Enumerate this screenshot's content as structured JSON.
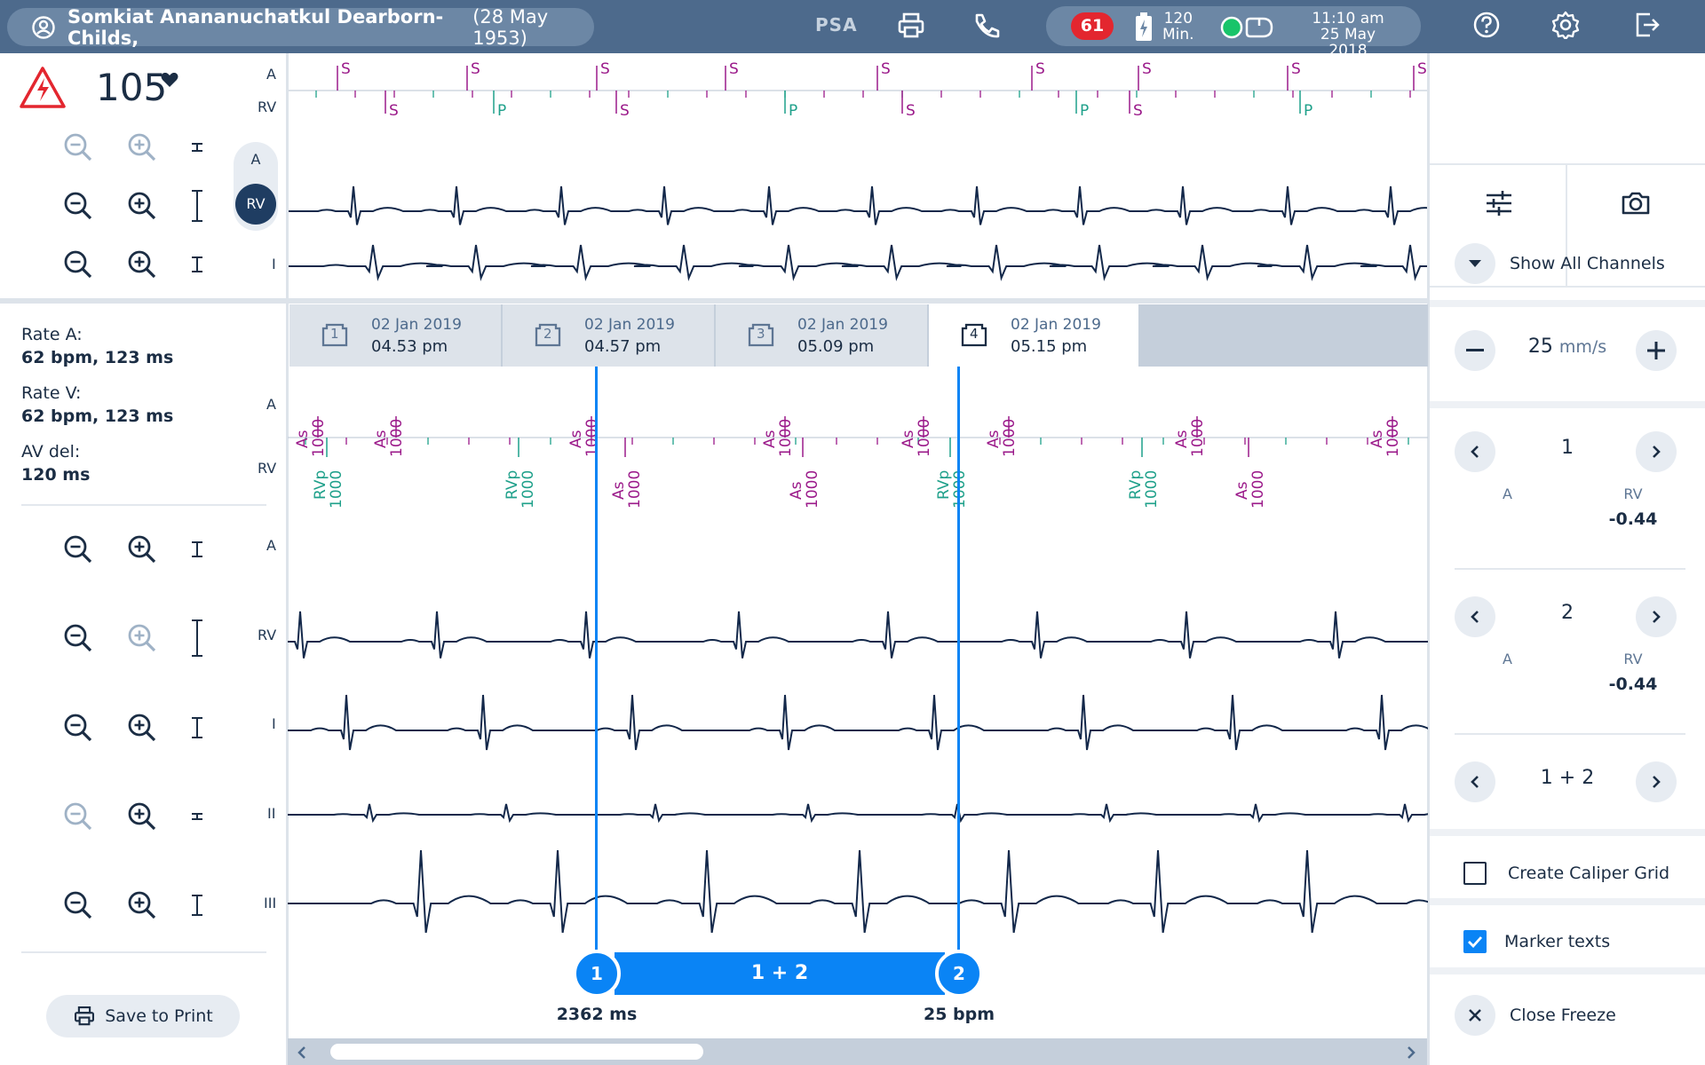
{
  "header": {
    "patient_name": "Somkiat Anananuchatkul Dearborn-Childs,",
    "patient_dob": "(28 May 1953)",
    "psa_label": "PSA",
    "counter": "61",
    "battery_value": "120",
    "battery_unit": "Min.",
    "time": "11:10 am",
    "date": "25 May 2018"
  },
  "vitals": {
    "heart_rate": "105"
  },
  "top_strip": {
    "channels": [
      "A",
      "RV",
      "I"
    ],
    "channel_toggle": [
      "A",
      "RV"
    ],
    "markers_a": [
      "S",
      "S",
      "S",
      "S",
      "S",
      "S",
      "S",
      "S",
      "S"
    ],
    "markers_rv": [
      "S",
      "P",
      "S",
      "P",
      "S",
      "P",
      "S",
      "P"
    ]
  },
  "info": {
    "rate_a_label": "Rate A:",
    "rate_a_value": "62 bpm, 123 ms",
    "rate_v_label": "Rate V:",
    "rate_v_value": "62 bpm, 123 ms",
    "av_del_label": "AV del:",
    "av_del_value": "120 ms"
  },
  "tabs": [
    {
      "num": "1",
      "date": "02 Jan 2019",
      "time": "04.53 pm"
    },
    {
      "num": "2",
      "date": "02 Jan 2019",
      "time": "04.57 pm"
    },
    {
      "num": "3",
      "date": "02 Jan 2019",
      "time": "05.09 pm"
    },
    {
      "num": "4",
      "date": "02 Jan 2019",
      "time": "05.15 pm"
    }
  ],
  "markers": {
    "a_label": "A",
    "rv_label": "RV",
    "a_top": [
      {
        "code": "As",
        "val": "1000"
      },
      {
        "code": "As",
        "val": "1000"
      },
      {
        "code": "As",
        "val": "1000"
      },
      {
        "code": "As",
        "val": "1000"
      },
      {
        "code": "As",
        "val": "1000"
      },
      {
        "code": "As",
        "val": "1000"
      },
      {
        "code": "As",
        "val": "1000"
      },
      {
        "code": "As",
        "val": "1000"
      }
    ],
    "rv_bottom": [
      {
        "code": "RVp",
        "val": "1000"
      },
      {
        "code": "RVp",
        "val": "1000"
      },
      {
        "code": "As",
        "val": "1000"
      },
      {
        "code": "As",
        "val": "1000"
      },
      {
        "code": "RVp",
        "val": "1000"
      },
      {
        "code": "RVp",
        "val": "1000"
      },
      {
        "code": "As",
        "val": "1000"
      }
    ]
  },
  "main_channels": [
    "A",
    "RV",
    "I",
    "II",
    "III"
  ],
  "caliper": {
    "handle1": "1",
    "handle2": "2",
    "bar_label": "1 + 2",
    "left_value": "2362 ms",
    "right_value": "25 bpm"
  },
  "buttons": {
    "save_to_print": "Save to Print"
  },
  "right_panel": {
    "show_all_channels": "Show All Channels",
    "speed_value": "25",
    "speed_unit": "mm/s",
    "caliper1": {
      "num": "1",
      "col_a": "A",
      "col_rv": "RV",
      "rv_value": "-0.44"
    },
    "caliper2": {
      "num": "2",
      "col_a": "A",
      "col_rv": "RV",
      "rv_value": "-0.44"
    },
    "caliper_pair": "1 + 2",
    "create_caliper_grid": "Create Caliper Grid",
    "marker_texts": "Marker texts",
    "close_freeze": "Close Freeze"
  },
  "colors": {
    "topbar": "#4d6a8c",
    "marker_purple": "#9b1a8a",
    "marker_teal": "#1ea08a",
    "caliper_blue": "#0a84f5",
    "alert_red": "#e3262f",
    "trace": "#13284a"
  },
  "icons": [
    "user-icon",
    "printer-icon",
    "phone-icon",
    "battery-icon",
    "connection-icon",
    "help-icon",
    "settings-icon",
    "logout-icon",
    "alert-triangle-icon",
    "heart-icon",
    "zoom-in-icon",
    "zoom-out-icon",
    "sliders-icon",
    "camera-icon",
    "chevron-down-icon",
    "minus-icon",
    "plus-icon",
    "chevron-left-icon",
    "chevron-right-icon",
    "checkbox-icon",
    "close-icon"
  ]
}
